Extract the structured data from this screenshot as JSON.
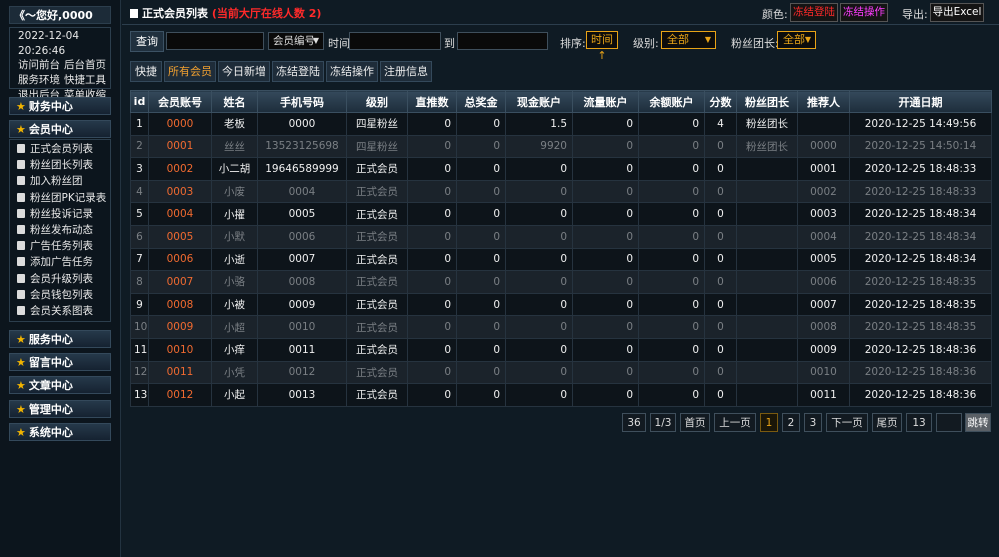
{
  "sidebar": {
    "greeting": "《～您好,0000",
    "datetime": "2022-12-04 20:26:46",
    "links": [
      [
        "访问前台",
        "后台首页"
      ],
      [
        "服务环境",
        "快捷工具"
      ],
      [
        "退出后台",
        "菜单收缩"
      ]
    ],
    "sections": [
      "财务中心",
      "会员中心",
      "服务中心",
      "留言中心",
      "文章中心",
      "管理中心",
      "系统中心"
    ],
    "member_items": [
      "正式会员列表",
      "粉丝团长列表",
      "加入粉丝团",
      "粉丝团PK记录表",
      "粉丝投诉记录",
      "粉丝发布动态",
      "广告任务列表",
      "添加广告任务",
      "会员升级列表",
      "会员钱包列表",
      "会员关系图表"
    ]
  },
  "header": {
    "title": "正式会员列表",
    "online_notice": "(当前大厅在线人数 2)",
    "color_label": "颜色:",
    "frozen_login": "冻结登陆",
    "frozen_op": "冻结操作",
    "export_label": "导出:",
    "export_btn": "导出Excel"
  },
  "search": {
    "query_btn": "查询",
    "field_select": "会员编号",
    "time_label": "时间",
    "to_label": "到",
    "sort_label": "排序:",
    "sort_btn": "时间↑",
    "level_label": "级别:",
    "level_value": "全部",
    "leader_label": "粉丝团长:",
    "leader_value": "全部"
  },
  "tabs": [
    "快捷",
    "所有会员",
    "今日新增",
    "冻结登陆",
    "冻结操作",
    "注册信息"
  ],
  "table": {
    "headers": [
      "id",
      "会员账号",
      "姓名",
      "手机号码",
      "级别",
      "直推数",
      "总奖金",
      "现金账户",
      "流量账户",
      "余额账户",
      "分数",
      "粉丝团长",
      "推荐人",
      "开通日期"
    ],
    "rows": [
      [
        "1",
        "0000",
        "老板",
        "0000",
        "四星粉丝",
        "0",
        "0",
        "1.5",
        "0",
        "0",
        "4",
        "粉丝团长",
        "",
        "2020-12-25 14:49:56"
      ],
      [
        "2",
        "0001",
        "丝丝",
        "13523125698",
        "四星粉丝",
        "0",
        "0",
        "9920",
        "0",
        "0",
        "0",
        "粉丝团长",
        "0000",
        "2020-12-25 14:50:14"
      ],
      [
        "3",
        "0002",
        "小二胡",
        "19646589999",
        "正式会员",
        "0",
        "0",
        "0",
        "0",
        "0",
        "0",
        "",
        "0001",
        "2020-12-25 18:48:33"
      ],
      [
        "4",
        "0003",
        "小废",
        "0004",
        "正式会员",
        "0",
        "0",
        "0",
        "0",
        "0",
        "0",
        "",
        "0002",
        "2020-12-25 18:48:33"
      ],
      [
        "5",
        "0004",
        "小擢",
        "0005",
        "正式会员",
        "0",
        "0",
        "0",
        "0",
        "0",
        "0",
        "",
        "0003",
        "2020-12-25 18:48:34"
      ],
      [
        "6",
        "0005",
        "小默",
        "0006",
        "正式会员",
        "0",
        "0",
        "0",
        "0",
        "0",
        "0",
        "",
        "0004",
        "2020-12-25 18:48:34"
      ],
      [
        "7",
        "0006",
        "小逝",
        "0007",
        "正式会员",
        "0",
        "0",
        "0",
        "0",
        "0",
        "0",
        "",
        "0005",
        "2020-12-25 18:48:34"
      ],
      [
        "8",
        "0007",
        "小骆",
        "0008",
        "正式会员",
        "0",
        "0",
        "0",
        "0",
        "0",
        "0",
        "",
        "0006",
        "2020-12-25 18:48:35"
      ],
      [
        "9",
        "0008",
        "小被",
        "0009",
        "正式会员",
        "0",
        "0",
        "0",
        "0",
        "0",
        "0",
        "",
        "0007",
        "2020-12-25 18:48:35"
      ],
      [
        "10",
        "0009",
        "小超",
        "0010",
        "正式会员",
        "0",
        "0",
        "0",
        "0",
        "0",
        "0",
        "",
        "0008",
        "2020-12-25 18:48:35"
      ],
      [
        "11",
        "0010",
        "小痒",
        "0011",
        "正式会员",
        "0",
        "0",
        "0",
        "0",
        "0",
        "0",
        "",
        "0009",
        "2020-12-25 18:48:36"
      ],
      [
        "12",
        "0011",
        "小凭",
        "0012",
        "正式会员",
        "0",
        "0",
        "0",
        "0",
        "0",
        "0",
        "",
        "0010",
        "2020-12-25 18:48:36"
      ],
      [
        "13",
        "0012",
        "小起",
        "0013",
        "正式会员",
        "0",
        "0",
        "0",
        "0",
        "0",
        "0",
        "",
        "0011",
        "2020-12-25 18:48:36"
      ]
    ]
  },
  "pager": {
    "total": "36",
    "page_of": "1/3",
    "first": "首页",
    "prev": "上一页",
    "pages": [
      "1",
      "2",
      "3"
    ],
    "current": "1",
    "next": "下一页",
    "last": "尾页",
    "jump_value": "13",
    "jump_btn": "跳转"
  },
  "colors": {
    "accent": "#e8a317",
    "danger": "#ff2a2a",
    "magenta": "#ff3cff",
    "account": "#f06a30"
  }
}
